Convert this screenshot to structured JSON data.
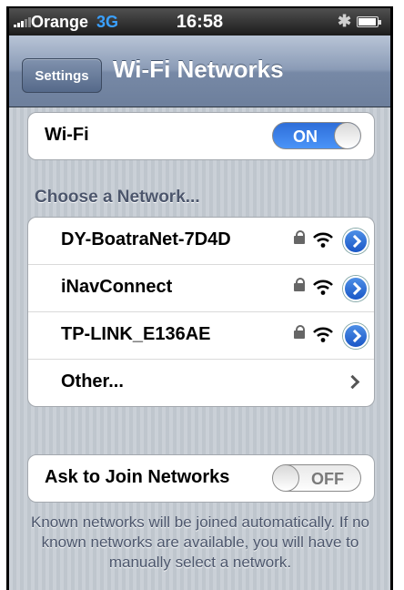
{
  "status_bar": {
    "carrier": "Orange",
    "network_type": "3G",
    "time": "16:58"
  },
  "nav": {
    "back_label": "Settings",
    "title": "Wi-Fi Networks"
  },
  "wifi_toggle": {
    "label": "Wi-Fi",
    "state": "ON"
  },
  "networks_header": "Choose a Network...",
  "networks": [
    {
      "name": "DY-BoatraNet-7D4D",
      "secured": true
    },
    {
      "name": "iNavConnect",
      "secured": true
    },
    {
      "name": "TP-LINK_E136AE",
      "secured": true
    }
  ],
  "other_label": "Other...",
  "ask_to_join": {
    "label": "Ask to Join Networks",
    "state": "OFF"
  },
  "footer_text": "Known networks will be joined automatically.  If no known networks are available, you will have to manually select a network.",
  "colors": {
    "nav_bar": "#6d7f9c",
    "toggle_on": "#2e6ed9",
    "background": "#c5ccd4"
  }
}
